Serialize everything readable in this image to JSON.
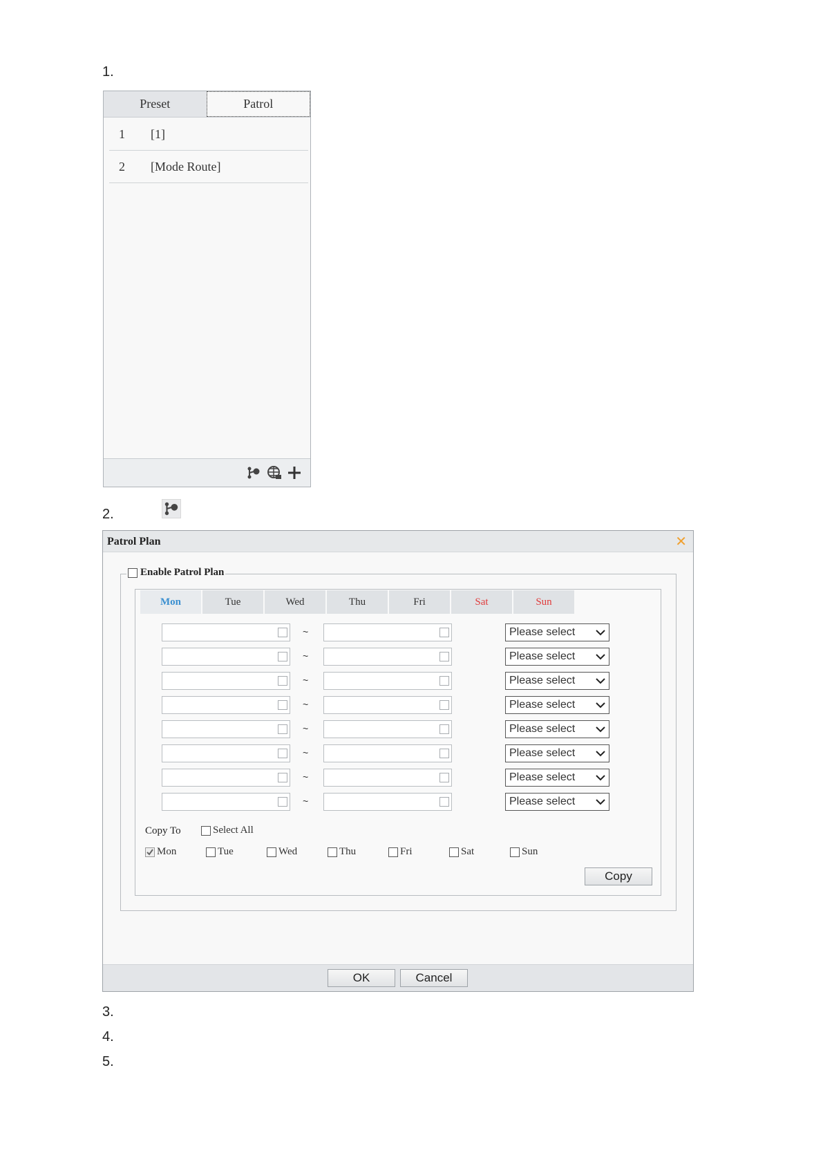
{
  "steps": [
    "1.",
    "2.",
    "3.",
    "4.",
    "5."
  ],
  "ptz_panel": {
    "tabs": [
      "Preset",
      "Patrol"
    ],
    "routes": [
      {
        "num": "1",
        "name": "[1]"
      },
      {
        "num": "2",
        "name": "[Mode Route]"
      }
    ],
    "footer_icons": [
      "patrol-plan-icon",
      "record-route-icon",
      "add-icon"
    ]
  },
  "inline_icon": "patrol-plan-icon",
  "dialog": {
    "title": "Patrol Plan",
    "close_glyph": "✕",
    "enable_label": "Enable Patrol Plan",
    "days": [
      "Mon",
      "Tue",
      "Wed",
      "Thu",
      "Fri",
      "Sat",
      "Sun"
    ],
    "active_day": "Mon",
    "weekend_color": "#e03a3a",
    "active_color": "#3a8fd0",
    "tilde": "~",
    "select_placeholder": "Please select",
    "copy_to_label": "Copy To",
    "select_all_label": "Select All",
    "copy_days": [
      "Mon",
      "Tue",
      "Wed",
      "Thu",
      "Fri",
      "Sat",
      "Sun"
    ],
    "copy_button": "Copy",
    "ok_button": "OK",
    "cancel_button": "Cancel"
  }
}
